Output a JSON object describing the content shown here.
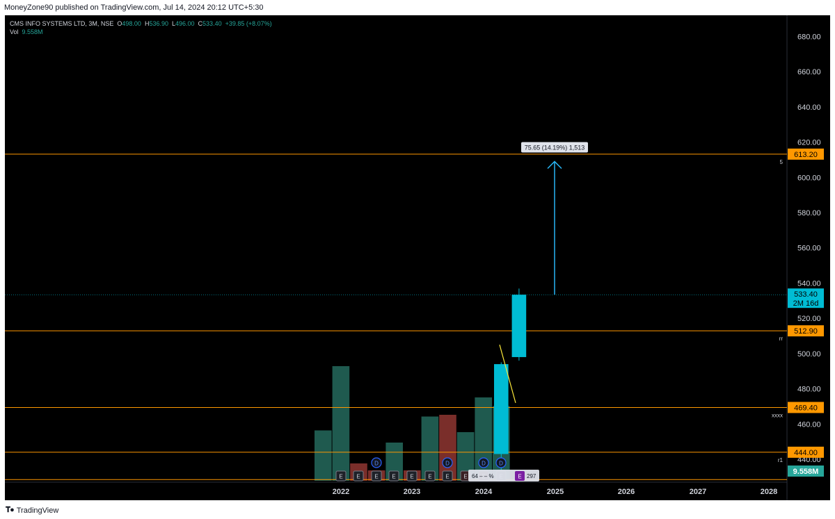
{
  "header": {
    "published": "MoneyZone90 published on TradingView.com, Jul 14, 2024 20:12 UTC+5:30"
  },
  "legend": {
    "symbol": "CMS INFO SYSTEMS LTD, 3M, NSE",
    "open_label": "O",
    "open": "498.00",
    "high_label": "H",
    "high": "536.90",
    "low_label": "L",
    "low": "496.00",
    "close_label": "C",
    "close": "533.40",
    "change": "+39.85 (+8.07%)",
    "vol_label": "Vol",
    "vol": "9.558M"
  },
  "footer": {
    "brand": "TradingView"
  },
  "colors": {
    "up": "#00bcd4",
    "volume_up": "#1f5a4f",
    "volume_down": "#7a2e2a",
    "level": "#ff9800",
    "measure": "#29b6f6"
  },
  "chart_data": {
    "type": "candlestick",
    "symbol": "CMS INFO SYSTEMS LTD",
    "interval": "3M",
    "exchange": "NSE",
    "y_axis": {
      "ticks": [
        "440.00",
        "460.00",
        "480.00",
        "500.00",
        "520.00",
        "540.00",
        "560.00",
        "580.00",
        "600.00",
        "620.00",
        "640.00",
        "660.00",
        "680.00"
      ],
      "range": [
        427,
        692
      ]
    },
    "x_axis": {
      "ticks": [
        "2022",
        "2023",
        "2024",
        "2025",
        "2026",
        "2027",
        "2028"
      ]
    },
    "candles": [
      {
        "period": "Q1 2024",
        "open": 443,
        "high": 495,
        "low": 430,
        "close": 494
      },
      {
        "period": "Q2 2024",
        "open": 498,
        "high": 536.9,
        "low": 496,
        "close": 533.4
      }
    ],
    "volume": [
      {
        "period": "Q1 2021",
        "height": 0.29,
        "direction": "up"
      },
      {
        "period": "Q2 2021",
        "height": 0.66,
        "direction": "up"
      },
      {
        "period": "Q3 2021",
        "height": 0.1,
        "direction": "down"
      },
      {
        "period": "Q4 2021",
        "height": 0.06,
        "direction": "down"
      },
      {
        "period": "Q1 2022",
        "height": 0.22,
        "direction": "up"
      },
      {
        "period": "Q2 2022",
        "height": 0.06,
        "direction": "down"
      },
      {
        "period": "Q3 2022",
        "height": 0.37,
        "direction": "up"
      },
      {
        "period": "Q4 2022",
        "height": 0.38,
        "direction": "down"
      },
      {
        "period": "Q1 2023",
        "height": 0.28,
        "direction": "up"
      },
      {
        "period": "Q2 2023",
        "height": 0.48,
        "direction": "up"
      },
      {
        "period": "Q3 2023",
        "height": 0.43,
        "direction": "up"
      }
    ],
    "levels": [
      {
        "price": 613.2,
        "label": "613.20",
        "tag": "5"
      },
      {
        "price": 512.9,
        "label": "512.90",
        "tag": "rr"
      },
      {
        "price": 469.4,
        "label": "469.40",
        "tag": "xxxx"
      },
      {
        "price": 444.0,
        "label": "444.00",
        "tag": "r1"
      },
      {
        "price": 428.5,
        "label": "",
        "tag": ""
      }
    ],
    "current_price": {
      "value": "533.40",
      "countdown": "2M 16d"
    },
    "volume_badge": "9.558M",
    "measure": {
      "from": 533.4,
      "to": 609,
      "label": "75.65 (14.19%) 1,513"
    },
    "trendline": {
      "from_price": 505,
      "to_price": 472
    },
    "events": {
      "earnings_count": 10,
      "dividend_count": 4,
      "earnings_label": "E",
      "dividend_label": "D",
      "tooltip": "64 – – %",
      "tooltip_tail": "297"
    },
    "grid": false,
    "legend_position": "top-left"
  }
}
